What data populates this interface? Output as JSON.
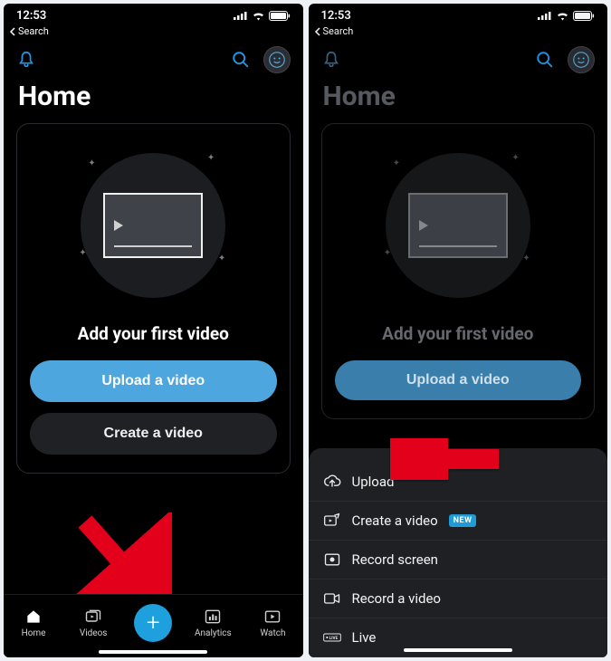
{
  "status": {
    "time": "12:53"
  },
  "back_label": "Search",
  "title": "Home",
  "empty": {
    "heading": "Add your first video",
    "primary": "Upload a video",
    "secondary": "Create a video"
  },
  "tabs": {
    "home": "Home",
    "videos": "Videos",
    "analytics": "Analytics",
    "watch": "Watch"
  },
  "sheet": {
    "upload": "Upload",
    "create": "Create a video",
    "create_badge": "NEW",
    "record_screen": "Record screen",
    "record_video": "Record a video",
    "live": "Live"
  }
}
